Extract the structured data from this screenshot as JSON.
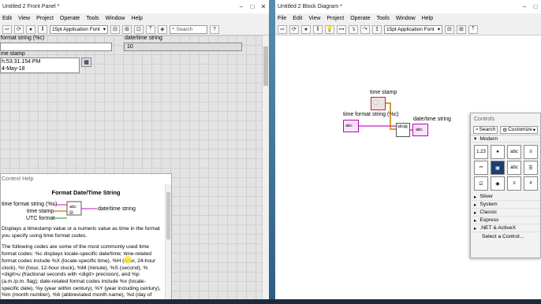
{
  "front_panel": {
    "title": "Untitled 2 Front Panel *",
    "menu": [
      "Edit",
      "View",
      "Project",
      "Operate",
      "Tools",
      "Window",
      "Help"
    ],
    "font_select": "15pt Application Font",
    "controls": {
      "format_label": "format string (%c)",
      "datetime_label": "date/time string",
      "datetime_value": "10",
      "timestamp_label": "me stamp",
      "timestamp_time": "h:53:31.154 PM",
      "timestamp_date": "4-May-18"
    },
    "context_help": {
      "header": "Context Help",
      "title": "Format Date/Time String",
      "term_format": "time format string (%c)",
      "term_timestamp": "time stamp",
      "term_utc": "UTC format",
      "term_output": "date/time string",
      "desc": "Displays a timestamp value or a numeric value as time in the format you specify using time format codes.",
      "body": "The following codes are some of the most commonly used time format codes: %c displays locale-specific date/time; time-related format codes include %X (locale-specific time), %H (hour, 24-hour clock), %I (hour, 12-hour clock), %M (minute), %S (second), %<digit>u (fractional seconds with <digit> precision), and %p (a.m./p.m. flag); date-related format codes include %x (locale-specific date), %y (year within century), %Y (year including century), %m (month number), %b (abbreviated month name), %d (day of month), and %a (abbreviated"
    }
  },
  "block_diagram": {
    "title": "Untitled 2 Block Diagram *",
    "menu": [
      "File",
      "Edit",
      "View",
      "Project",
      "Operate",
      "Tools",
      "Window",
      "Help"
    ],
    "font_select": "15pt Application Font",
    "search_placeholder": "Search",
    "nodes": {
      "time_stamp": "time stamp",
      "format_string": "time format string (%c)",
      "output": "date/time string"
    }
  },
  "search_placeholder": "Search",
  "palette": {
    "title": "Controls",
    "search": "Search",
    "customize": "Customize",
    "categories": [
      "Modern",
      "Silver",
      "System",
      "Classic",
      "Express",
      ".NET & ActiveX"
    ],
    "select_control": "Select a Control...",
    "icon_labels": [
      "abc",
      "1.23",
      "●",
      "abc",
      "≡",
      "⎓",
      "▣",
      "☰",
      "☑",
      "◉",
      "≡",
      "#",
      "abc",
      "▤",
      "⚙",
      "⌘"
    ]
  },
  "colors": {
    "wire_pink": "#d040c8",
    "wire_orange": "#c87800",
    "accent": "#1b3f6e"
  }
}
